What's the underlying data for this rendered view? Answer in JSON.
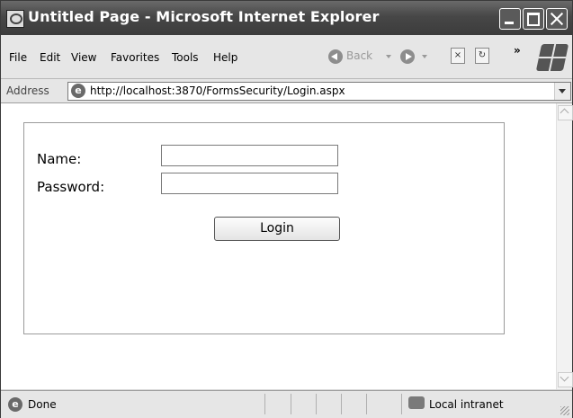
{
  "window": {
    "title": "Untitled Page - Microsoft Internet Explorer"
  },
  "menu": {
    "items": [
      "File",
      "Edit",
      "View",
      "Favorites",
      "Tools",
      "Help"
    ]
  },
  "toolbar": {
    "back_label": "Back",
    "overflow": "»"
  },
  "address": {
    "label": "Address",
    "url": "http://localhost:3870/FormsSecurity/Login.aspx"
  },
  "form": {
    "name_label": "Name:",
    "password_label": "Password:",
    "name_value": "",
    "password_value": "",
    "login_button": "Login"
  },
  "status": {
    "text": "Done",
    "zone": "Local intranet"
  },
  "icons": [
    "ie-page-icon",
    "minimize-icon",
    "maximize-icon",
    "close-icon",
    "back-icon",
    "forward-icon",
    "stop-icon",
    "refresh-icon",
    "windows-logo-icon",
    "scroll-up-icon",
    "scroll-down-icon",
    "zone-icon"
  ]
}
